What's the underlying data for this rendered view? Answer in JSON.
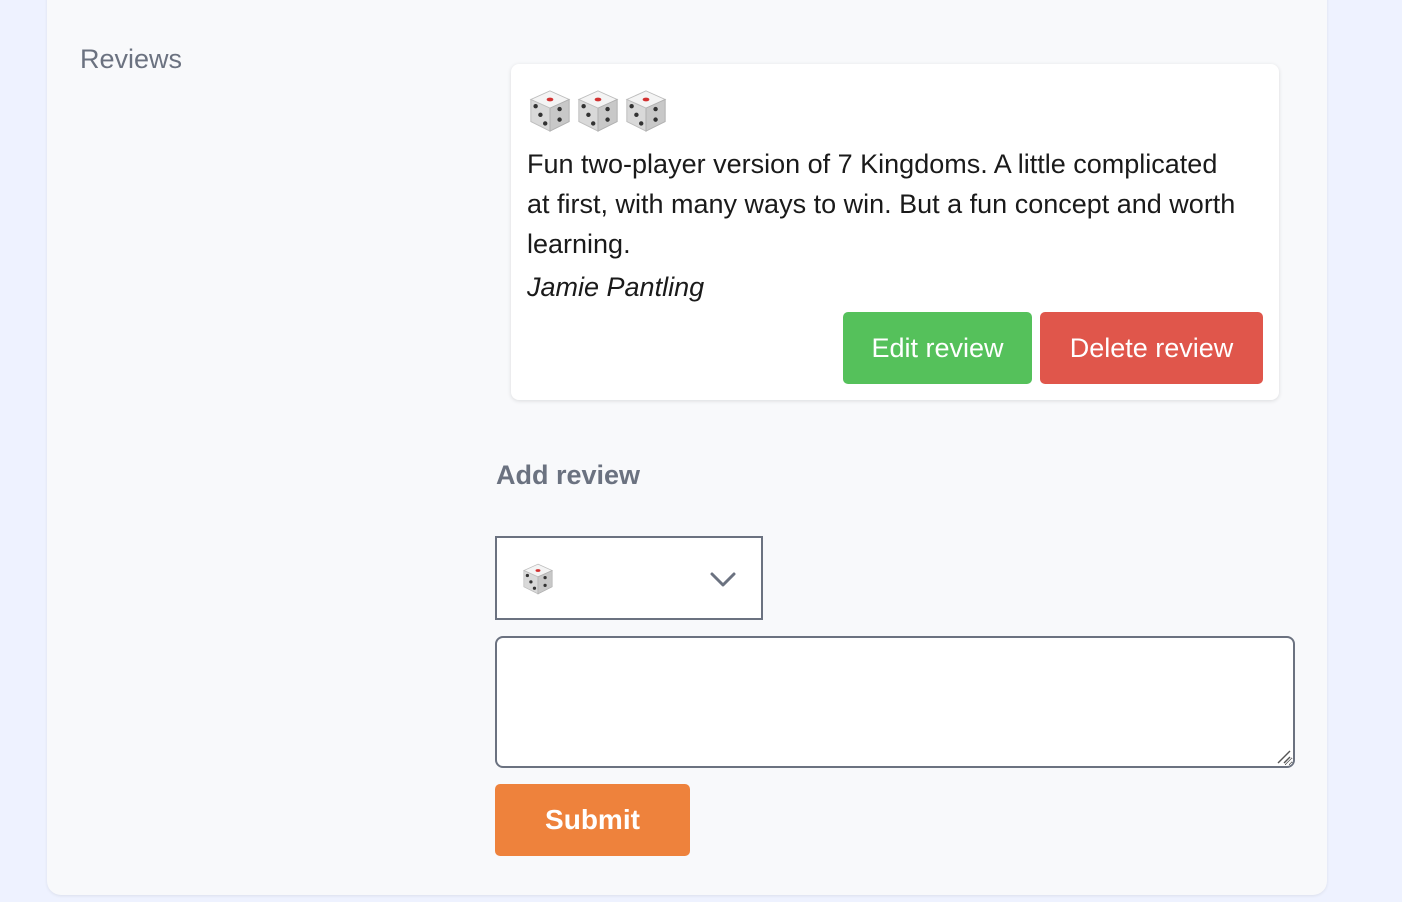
{
  "reviews": {
    "section_label": "Reviews",
    "items": [
      {
        "rating": 3,
        "rating_icon": "dice-icon",
        "text": "Fun two-player version of 7 Kingdoms. A little complicated at first, with many ways to win. But a fun concept and worth learning.",
        "author": "Jamie Pantling",
        "edit_label": "Edit review",
        "delete_label": "Delete review"
      }
    ]
  },
  "add_review": {
    "heading": "Add review",
    "rating_select": {
      "selected_rating": 1,
      "icon": "dice-icon"
    },
    "textarea": {
      "value": "",
      "placeholder": ""
    },
    "submit_label": "Submit"
  },
  "colors": {
    "edit_button": "#55c15b",
    "delete_button": "#e0564b",
    "submit_button": "#ee823c",
    "muted_text": "#6b7280"
  }
}
